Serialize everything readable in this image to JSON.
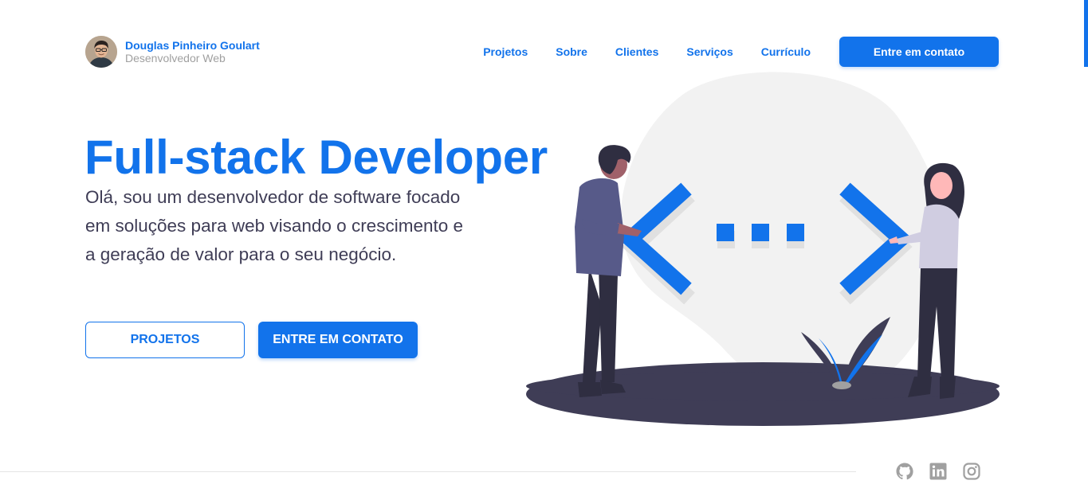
{
  "brand": {
    "name": "Douglas Pinheiro Goulart",
    "role": "Desenvolvedor Web"
  },
  "nav": {
    "items": [
      {
        "label": "Projetos"
      },
      {
        "label": "Sobre"
      },
      {
        "label": "Clientes"
      },
      {
        "label": "Serviços"
      },
      {
        "label": "Currículo"
      }
    ],
    "cta_label": "Entre em contato"
  },
  "hero": {
    "title": "Full-stack Developer",
    "description": "Olá, sou um desenvolvedor de software focado em soluções para web visando o crescimento e a geração de valor para o seu negócio.",
    "primary_button": "PROJETOS",
    "secondary_button": "ENTRE EM CONTATO"
  },
  "socials": [
    {
      "icon": "github-icon"
    },
    {
      "icon": "linkedin-icon"
    },
    {
      "icon": "instagram-icon"
    }
  ],
  "colors": {
    "accent": "#1273eb",
    "text": "#3f3d56",
    "muted": "#a0a0a0"
  }
}
